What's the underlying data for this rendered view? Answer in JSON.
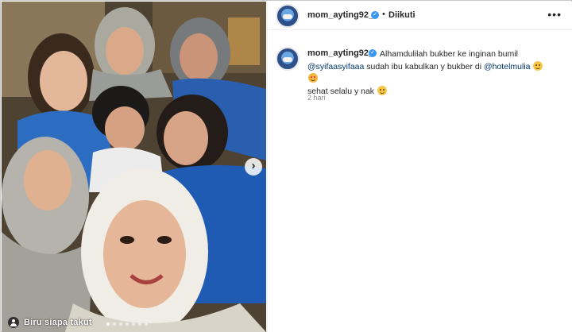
{
  "post": {
    "author": "mom_ayting92_",
    "follow_status": "Diikuti",
    "separator": "•",
    "more_icon": "more-horizontal-icon"
  },
  "media": {
    "overlay_text": "Biru siapa takut",
    "next_icon": "chevron-right-icon",
    "tag_icon": "user-tag-icon",
    "carousel_count": 7,
    "carousel_active": 1
  },
  "caption": {
    "author": "mom_ayting92_",
    "text_1": "Alhamdulilah bukber ke inginan bumil",
    "mention_1": "@syifaasyifaaa",
    "text_2": "sudah ibu kabulkan y bukber di",
    "mention_2": "@hotelmulia",
    "text_3": "sehat selalu y nak",
    "emojis": [
      "smiling-face-with-hand-icon",
      "smiling-face-with-hearts-icon",
      "smiling-face-with-hand-icon"
    ],
    "timestamp": "2 hari"
  },
  "colors": {
    "link": "#00376b",
    "verified": "#3897f0",
    "muted": "#8e8e8e"
  }
}
